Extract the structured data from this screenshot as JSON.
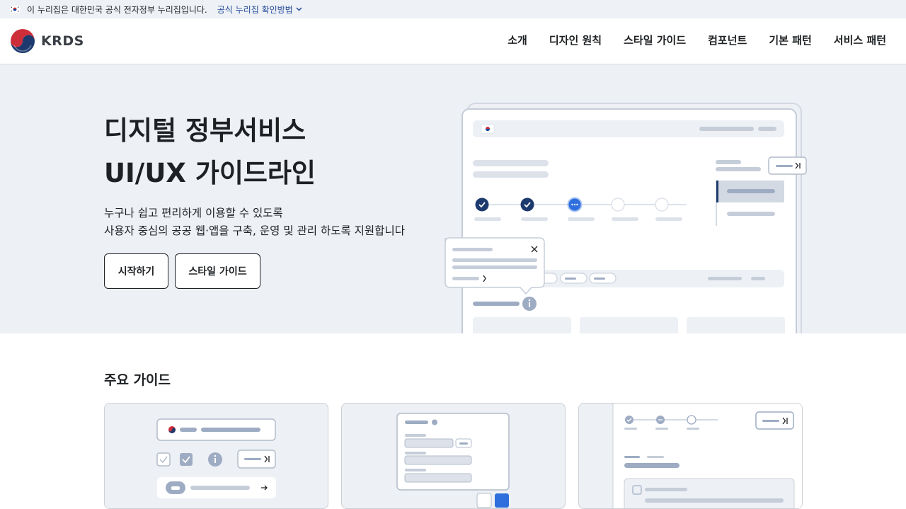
{
  "gov_banner": {
    "notice": "이 누리집은 대한민국 공식 전자정부 누리집입니다.",
    "verify_link": "공식 누리집 확인방법"
  },
  "header": {
    "logo_text": "KRDS",
    "nav": [
      "소개",
      "디자인 원칙",
      "스타일 가이드",
      "컴포넌트",
      "기본 패턴",
      "서비스 패턴"
    ]
  },
  "hero": {
    "title_line1": "디지털 정부서비스",
    "title_line2": "UI/UX 가이드라인",
    "desc_line1": "누구나 쉽고 편리하게 이용할 수 있도록",
    "desc_line2": "사용자 중심의 공공 웹·앱을 구축, 운영 및 관리 하도록 지원합니다",
    "start_button": "시작하기",
    "style_guide_button": "스타일 가이드"
  },
  "guides": {
    "title": "주요 가이드"
  },
  "colors": {
    "accent_navy": "#1c3a6e",
    "accent_blue": "#2f6fdd",
    "hero_bg": "#edf0f4",
    "placeholder": "#c5cdd9"
  }
}
